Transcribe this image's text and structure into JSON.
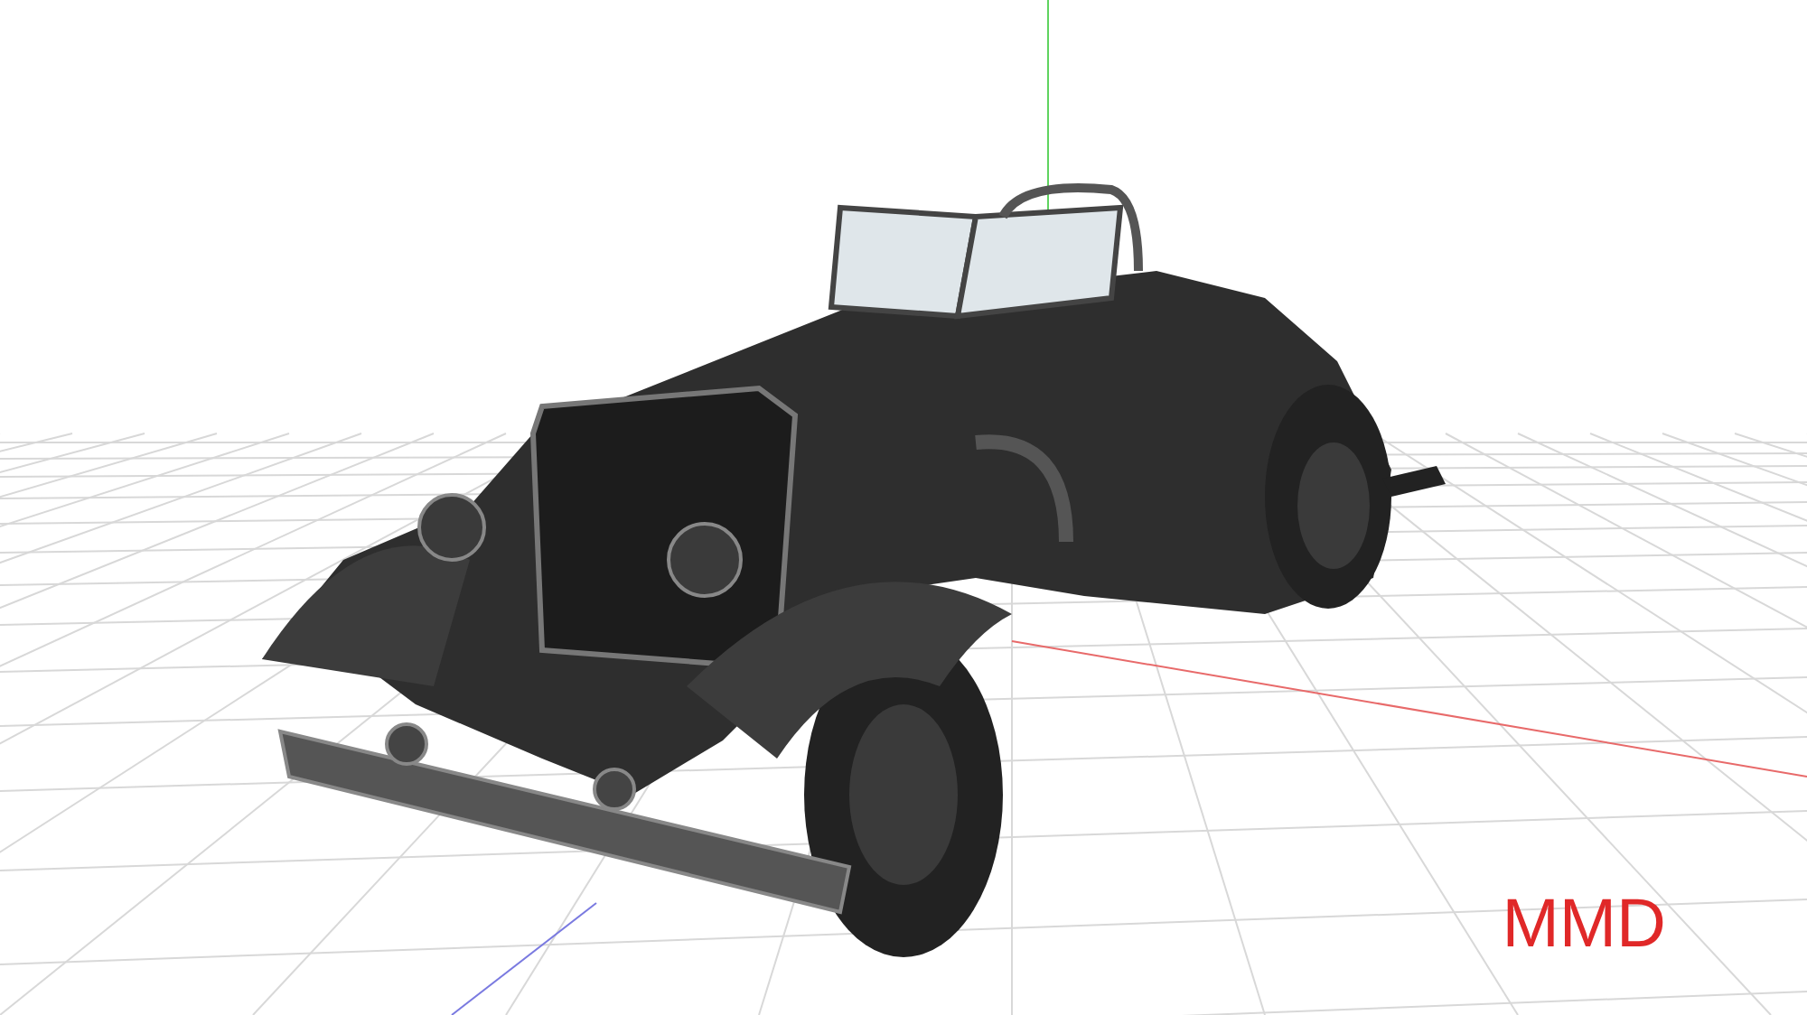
{
  "viewport": {
    "label": "MMD"
  }
}
